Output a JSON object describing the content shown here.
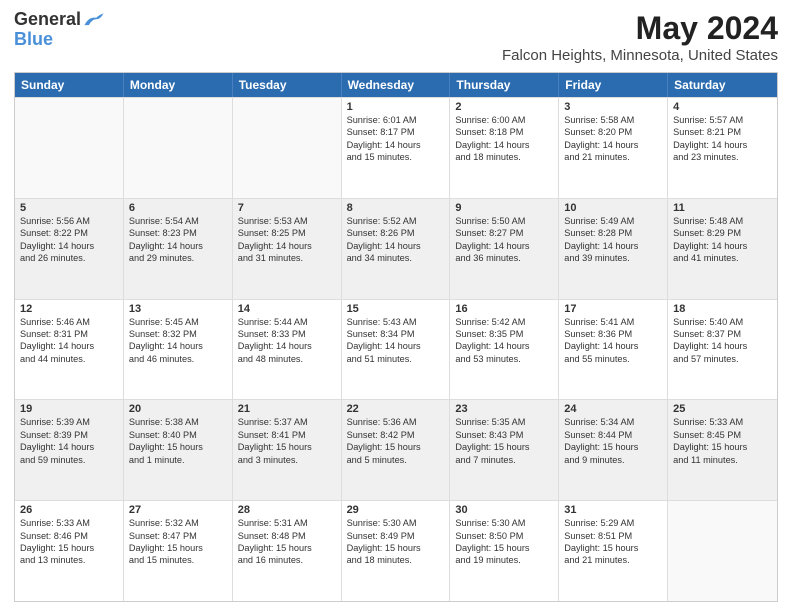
{
  "logo": {
    "line1": "General",
    "line2": "Blue"
  },
  "title": "May 2024",
  "subtitle": "Falcon Heights, Minnesota, United States",
  "days": [
    "Sunday",
    "Monday",
    "Tuesday",
    "Wednesday",
    "Thursday",
    "Friday",
    "Saturday"
  ],
  "rows": [
    [
      {
        "num": "",
        "text": ""
      },
      {
        "num": "",
        "text": ""
      },
      {
        "num": "",
        "text": ""
      },
      {
        "num": "1",
        "text": "Sunrise: 6:01 AM\nSunset: 8:17 PM\nDaylight: 14 hours\nand 15 minutes."
      },
      {
        "num": "2",
        "text": "Sunrise: 6:00 AM\nSunset: 8:18 PM\nDaylight: 14 hours\nand 18 minutes."
      },
      {
        "num": "3",
        "text": "Sunrise: 5:58 AM\nSunset: 8:20 PM\nDaylight: 14 hours\nand 21 minutes."
      },
      {
        "num": "4",
        "text": "Sunrise: 5:57 AM\nSunset: 8:21 PM\nDaylight: 14 hours\nand 23 minutes."
      }
    ],
    [
      {
        "num": "5",
        "text": "Sunrise: 5:56 AM\nSunset: 8:22 PM\nDaylight: 14 hours\nand 26 minutes."
      },
      {
        "num": "6",
        "text": "Sunrise: 5:54 AM\nSunset: 8:23 PM\nDaylight: 14 hours\nand 29 minutes."
      },
      {
        "num": "7",
        "text": "Sunrise: 5:53 AM\nSunset: 8:25 PM\nDaylight: 14 hours\nand 31 minutes."
      },
      {
        "num": "8",
        "text": "Sunrise: 5:52 AM\nSunset: 8:26 PM\nDaylight: 14 hours\nand 34 minutes."
      },
      {
        "num": "9",
        "text": "Sunrise: 5:50 AM\nSunset: 8:27 PM\nDaylight: 14 hours\nand 36 minutes."
      },
      {
        "num": "10",
        "text": "Sunrise: 5:49 AM\nSunset: 8:28 PM\nDaylight: 14 hours\nand 39 minutes."
      },
      {
        "num": "11",
        "text": "Sunrise: 5:48 AM\nSunset: 8:29 PM\nDaylight: 14 hours\nand 41 minutes."
      }
    ],
    [
      {
        "num": "12",
        "text": "Sunrise: 5:46 AM\nSunset: 8:31 PM\nDaylight: 14 hours\nand 44 minutes."
      },
      {
        "num": "13",
        "text": "Sunrise: 5:45 AM\nSunset: 8:32 PM\nDaylight: 14 hours\nand 46 minutes."
      },
      {
        "num": "14",
        "text": "Sunrise: 5:44 AM\nSunset: 8:33 PM\nDaylight: 14 hours\nand 48 minutes."
      },
      {
        "num": "15",
        "text": "Sunrise: 5:43 AM\nSunset: 8:34 PM\nDaylight: 14 hours\nand 51 minutes."
      },
      {
        "num": "16",
        "text": "Sunrise: 5:42 AM\nSunset: 8:35 PM\nDaylight: 14 hours\nand 53 minutes."
      },
      {
        "num": "17",
        "text": "Sunrise: 5:41 AM\nSunset: 8:36 PM\nDaylight: 14 hours\nand 55 minutes."
      },
      {
        "num": "18",
        "text": "Sunrise: 5:40 AM\nSunset: 8:37 PM\nDaylight: 14 hours\nand 57 minutes."
      }
    ],
    [
      {
        "num": "19",
        "text": "Sunrise: 5:39 AM\nSunset: 8:39 PM\nDaylight: 14 hours\nand 59 minutes."
      },
      {
        "num": "20",
        "text": "Sunrise: 5:38 AM\nSunset: 8:40 PM\nDaylight: 15 hours\nand 1 minute."
      },
      {
        "num": "21",
        "text": "Sunrise: 5:37 AM\nSunset: 8:41 PM\nDaylight: 15 hours\nand 3 minutes."
      },
      {
        "num": "22",
        "text": "Sunrise: 5:36 AM\nSunset: 8:42 PM\nDaylight: 15 hours\nand 5 minutes."
      },
      {
        "num": "23",
        "text": "Sunrise: 5:35 AM\nSunset: 8:43 PM\nDaylight: 15 hours\nand 7 minutes."
      },
      {
        "num": "24",
        "text": "Sunrise: 5:34 AM\nSunset: 8:44 PM\nDaylight: 15 hours\nand 9 minutes."
      },
      {
        "num": "25",
        "text": "Sunrise: 5:33 AM\nSunset: 8:45 PM\nDaylight: 15 hours\nand 11 minutes."
      }
    ],
    [
      {
        "num": "26",
        "text": "Sunrise: 5:33 AM\nSunset: 8:46 PM\nDaylight: 15 hours\nand 13 minutes."
      },
      {
        "num": "27",
        "text": "Sunrise: 5:32 AM\nSunset: 8:47 PM\nDaylight: 15 hours\nand 15 minutes."
      },
      {
        "num": "28",
        "text": "Sunrise: 5:31 AM\nSunset: 8:48 PM\nDaylight: 15 hours\nand 16 minutes."
      },
      {
        "num": "29",
        "text": "Sunrise: 5:30 AM\nSunset: 8:49 PM\nDaylight: 15 hours\nand 18 minutes."
      },
      {
        "num": "30",
        "text": "Sunrise: 5:30 AM\nSunset: 8:50 PM\nDaylight: 15 hours\nand 19 minutes."
      },
      {
        "num": "31",
        "text": "Sunrise: 5:29 AM\nSunset: 8:51 PM\nDaylight: 15 hours\nand 21 minutes."
      },
      {
        "num": "",
        "text": ""
      }
    ]
  ]
}
